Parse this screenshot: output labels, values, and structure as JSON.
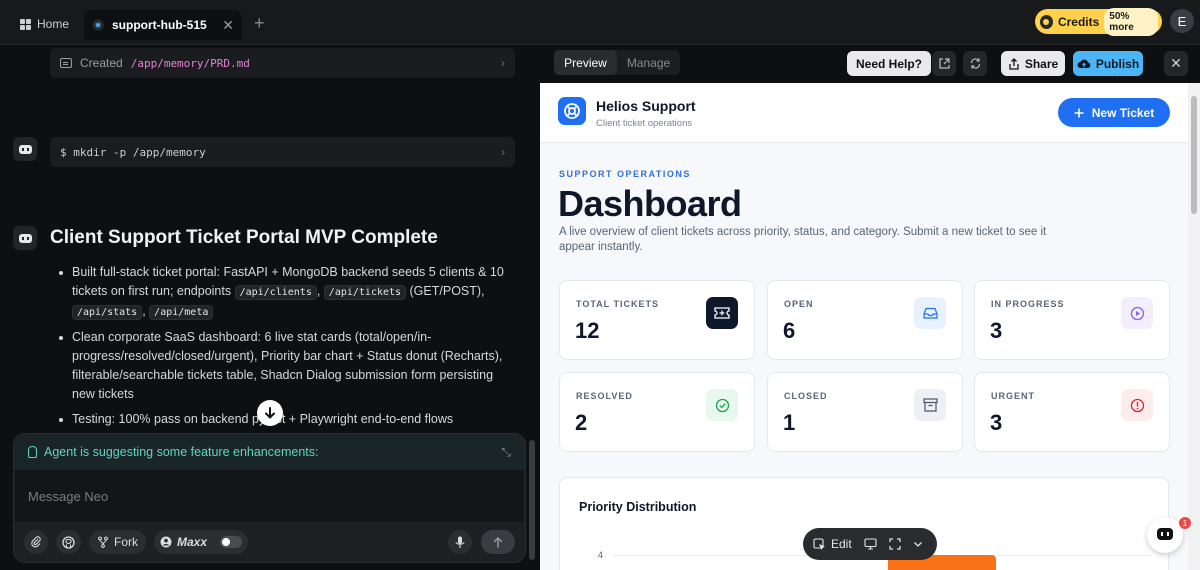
{
  "tabs": {
    "home": "Home",
    "active": "support-hub-515",
    "close": "✕",
    "add": "+"
  },
  "credits": {
    "label": "Credits",
    "more": "50% more"
  },
  "user": {
    "avatar_initial": "E"
  },
  "left": {
    "created_label": "Created",
    "created_path": "/app/memory/PRD.md",
    "mkdir_cmd": "$ mkdir -p /app/memory",
    "summary_title": "Client Support Ticket Portal MVP Complete",
    "bullet1": {
      "a": "Built full-stack ticket portal: FastAPI + MongoDB backend seeds 5 clients & 10 tickets on first run; endpoints ",
      "c1": "/api/clients",
      "s1": ", ",
      "c2": "/api/tickets",
      "b": " (GET/POST), ",
      "c3": "/api/stats",
      "s2": ", ",
      "c4": "/api/meta"
    },
    "bullet2": "Clean corporate SaaS dashboard: 6 live stat cards (total/open/in-progress/resolved/closed/urgent), Priority bar chart + Status donut (Recharts), filterable/searchable tickets table, Shadcn Dialog submission form persisting new tickets",
    "bullet3": "Testing: 100% pass on backend pytest + Playwright end-to-end flows"
  },
  "composer": {
    "suggestion": "Agent is suggesting some feature enhancements:",
    "placeholder": "Message Neo",
    "fork": "Fork",
    "maxx": "Maxx"
  },
  "preview_bar": {
    "tab_preview": "Preview",
    "tab_manage": "Manage",
    "need_help": "Need Help?",
    "share": "Share",
    "publish": "Publish"
  },
  "app": {
    "brand": "Helios Support",
    "brand_sub": "Client ticket operations",
    "new_ticket": "New Ticket",
    "eyebrow": "SUPPORT OPERATIONS",
    "title": "Dashboard",
    "description": "A live overview of client tickets across priority, status, and category. Submit a new ticket to see it appear instantly.",
    "stats": [
      {
        "label": "TOTAL TICKETS",
        "value": "12"
      },
      {
        "label": "OPEN",
        "value": "6"
      },
      {
        "label": "IN PROGRESS",
        "value": "3"
      },
      {
        "label": "RESOLVED",
        "value": "2"
      },
      {
        "label": "CLOSED",
        "value": "1"
      },
      {
        "label": "URGENT",
        "value": "3"
      }
    ],
    "chart_title": "Priority Distribution",
    "chart_tick": "4"
  },
  "float_bar": {
    "edit": "Edit"
  },
  "chat": {
    "badge": "1"
  },
  "colors": {
    "accent": "#1f6ff2",
    "publish": "#4bb5f5",
    "credits": "#ffd24a",
    "suggestion": "#5fd4c4",
    "path": "#e483d6",
    "bar": "#f97316"
  }
}
